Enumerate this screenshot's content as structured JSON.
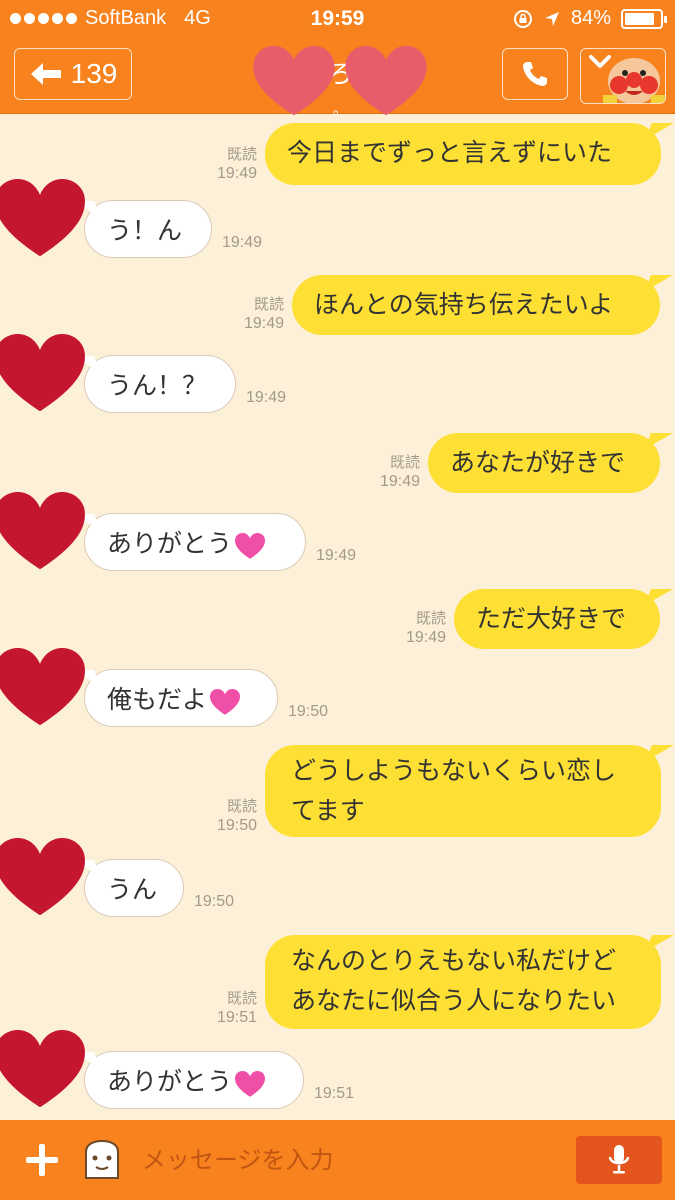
{
  "status_bar": {
    "carrier": "SoftBank",
    "network": "4G",
    "time": "19:59",
    "battery_percent": "84%",
    "battery_level": 0.84
  },
  "header": {
    "back_count": "139",
    "title": "ろ",
    "subtitle": "。"
  },
  "messages": [
    {
      "side": "me",
      "lines": [
        "今日までずっと言えずにいた"
      ],
      "read": "既読",
      "time": "19:49"
    },
    {
      "side": "them",
      "lines": [
        "う！ん"
      ],
      "time": "19:49"
    },
    {
      "side": "me",
      "lines": [
        "ほんとの気持ち伝えたいよ"
      ],
      "read": "既読",
      "time": "19:49"
    },
    {
      "side": "them",
      "lines": [
        "うん！？"
      ],
      "time": "19:49"
    },
    {
      "side": "me",
      "lines": [
        "あなたが好きで"
      ],
      "read": "既読",
      "time": "19:49"
    },
    {
      "side": "them",
      "lines": [
        "ありがとう"
      ],
      "time": "19:49",
      "emoji": "heart"
    },
    {
      "side": "me",
      "lines": [
        "ただ大好きで"
      ],
      "read": "既読",
      "time": "19:49"
    },
    {
      "side": "them",
      "lines": [
        "俺もだよ"
      ],
      "time": "19:50",
      "emoji": "heart"
    },
    {
      "side": "me",
      "lines": [
        "どうしようもないくらい恋し",
        "てます"
      ],
      "read": "既読",
      "time": "19:50"
    },
    {
      "side": "them",
      "lines": [
        "うん"
      ],
      "time": "19:50"
    },
    {
      "side": "me",
      "lines": [
        "なんのとりえもない私だけど",
        "あなたに似合う人になりたい"
      ],
      "read": "既読",
      "time": "19:51"
    },
    {
      "side": "them",
      "lines": [
        "ありがとう"
      ],
      "time": "19:51",
      "emoji": "heart"
    }
  ],
  "input": {
    "placeholder": "メッセージを入力"
  },
  "colors": {
    "brand_orange": "#f7821e",
    "chat_background": "#fdf0d9",
    "my_bubble": "#fde033",
    "avatar_heart": "#c4162f",
    "cover_heart": "#e85a6e",
    "mic_button": "#e3551d"
  },
  "icons": {
    "back": "arrow-left-icon",
    "call": "phone-icon",
    "menu": "chevron-down-icon",
    "add": "plus-icon",
    "sticker": "sticker-icon",
    "mic": "microphone-icon"
  }
}
